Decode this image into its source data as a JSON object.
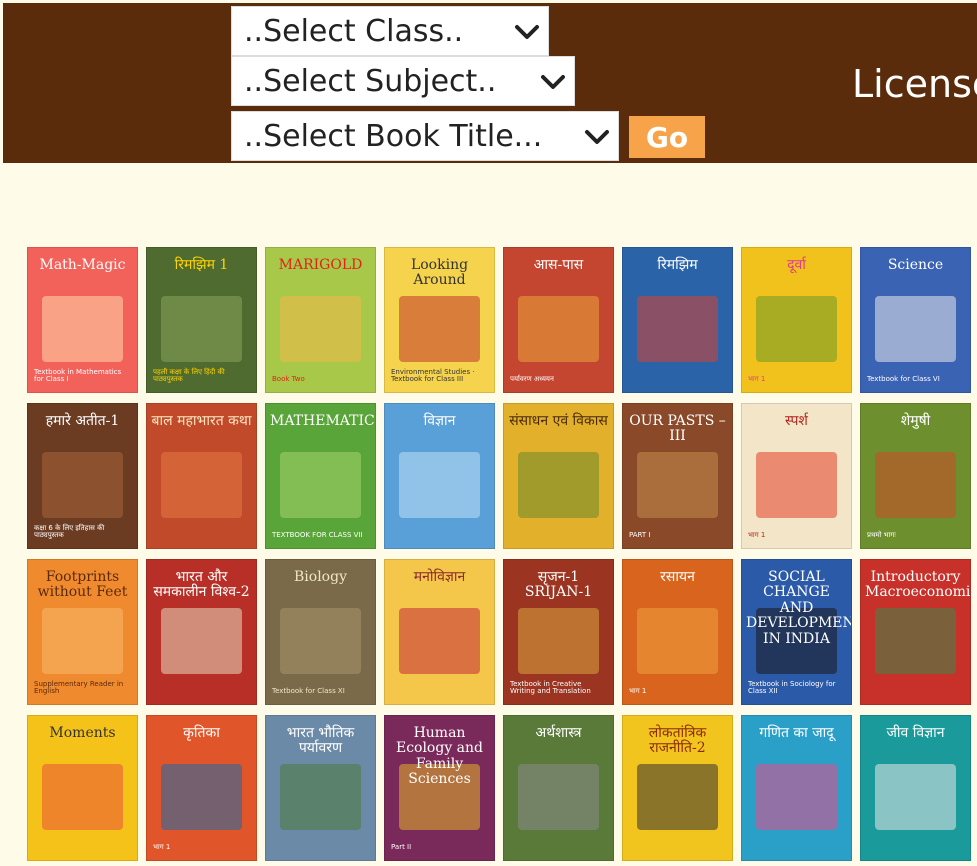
{
  "header": {
    "select_class": "..Select Class..",
    "select_subject": "..Select Subject..",
    "select_book_title": "..Select Book Title...",
    "go_label": "Go",
    "license_text": "License"
  },
  "books": [
    {
      "title": "Math-Magic",
      "sub": "Textbook in Mathematics for Class I",
      "bg": "#f2625b",
      "fg": "#ffffff",
      "art": "#ffd7a8"
    },
    {
      "title": "रिमझिम 1",
      "sub": "पहली कक्षा के लिए हिंदी की पाठ्यपुस्तक",
      "bg": "#4f6b2f",
      "fg": "#ffd400",
      "art": "#8aa45a"
    },
    {
      "title": "MARIGOLD",
      "sub": "Book Two",
      "bg": "#a8c84a",
      "fg": "#e2231a",
      "art": "#f0b94a"
    },
    {
      "title": "Looking Around",
      "sub": "Environmental Studies · Textbook for Class III",
      "bg": "#f6d34c",
      "fg": "#333333",
      "art": "#c0392b"
    },
    {
      "title": "आस-पास",
      "sub": "पर्यावरण अध्ययन",
      "bg": "#c44530",
      "fg": "#ffffff",
      "art": "#e9a43c"
    },
    {
      "title": "रिमझिम",
      "sub": "",
      "bg": "#2a63a8",
      "fg": "#ffffff",
      "art": "#d8412f"
    },
    {
      "title": "दूर्वा",
      "sub": "भाग 1",
      "bg": "#f2c21c",
      "fg": "#e03c8a",
      "art": "#6a9a2a"
    },
    {
      "title": "Science",
      "sub": "Textbook for Class VI",
      "bg": "#3a63b4",
      "fg": "#ffffff",
      "art": "#e9e9e9"
    },
    {
      "title": "हमारे अतीत-1",
      "sub": "कक्षा 6 के लिए इतिहास की पाठ्यपुस्तक",
      "bg": "#6b3b22",
      "fg": "#ffffff",
      "art": "#a8643a"
    },
    {
      "title": "बाल महाभारत कथा",
      "sub": "",
      "bg": "#c14a2a",
      "fg": "#ffe7c2",
      "art": "#e37a42"
    },
    {
      "title": "MATHEMATICS",
      "sub": "TEXTBOOK FOR CLASS VII",
      "bg": "#5aa53a",
      "fg": "#ffffff",
      "art": "#a6d46a"
    },
    {
      "title": "विज्ञान",
      "sub": "",
      "bg": "#5aa0d8",
      "fg": "#ffffff",
      "art": "#bfe0f5"
    },
    {
      "title": "संसाधन एवं विकास",
      "sub": "",
      "bg": "#e2b02a",
      "fg": "#4a2a0a",
      "art": "#6a8a2a"
    },
    {
      "title": "OUR PASTS – III",
      "sub": "PART I",
      "bg": "#8a4a2a",
      "fg": "#ffffff",
      "art": "#c48a4a"
    },
    {
      "title": "स्पर्श",
      "sub": "भाग 1",
      "bg": "#f3e6c8",
      "fg": "#b0261f",
      "art": "#e2402a"
    },
    {
      "title": "शेमुषी",
      "sub": "प्रथमो भागः",
      "bg": "#6e8f2e",
      "fg": "#ffffff",
      "art": "#d04a2a"
    },
    {
      "title": "Footprints without Feet",
      "sub": "Supplementary Reader in English",
      "bg": "#f08a2e",
      "fg": "#5a2a0a",
      "art": "#f7b86a"
    },
    {
      "title": "भारत और समकालीन विश्व-2",
      "sub": "",
      "bg": "#b82f27",
      "fg": "#ffffff",
      "art": "#e8d8c0"
    },
    {
      "title": "Biology",
      "sub": "Textbook for Class XI",
      "bg": "#7a6a4a",
      "fg": "#f0e6c8",
      "art": "#a8946a"
    },
    {
      "title": "मनोविज्ञान",
      "sub": "",
      "bg": "#f4c74a",
      "fg": "#8a2a2a",
      "art": "#c42a3a"
    },
    {
      "title": "सृजन-1 SRIJAN-1",
      "sub": "Textbook in Creative Writing and Translation",
      "bg": "#9b3420",
      "fg": "#ffffff",
      "art": "#d8a640"
    },
    {
      "title": "रसायन",
      "sub": "भाग 1",
      "bg": "#d8641e",
      "fg": "#ffffff",
      "art": "#f0a040"
    },
    {
      "title": "SOCIAL CHANGE AND DEVELOPMENT IN INDIA",
      "sub": "Textbook in Sociology for Class XII",
      "bg": "#2a5aa8",
      "fg": "#ffffff",
      "art": "#1a1a1a"
    },
    {
      "title": "Introductory Macroeconomics",
      "sub": "",
      "bg": "#c8302a",
      "fg": "#ffffff",
      "art": "#3a8a4a"
    },
    {
      "title": "Moments",
      "sub": "",
      "bg": "#f5c21a",
      "fg": "#333333",
      "art": "#e8543a"
    },
    {
      "title": "कृतिका",
      "sub": "भाग 1",
      "bg": "#e0552a",
      "fg": "#ffffff",
      "art": "#1d6aa8"
    },
    {
      "title": "भारत भौतिक पर्यावरण",
      "sub": "",
      "bg": "#6a8aa8",
      "fg": "#ffffff",
      "art": "#4a7a3a"
    },
    {
      "title": "Human Ecology and Family Sciences",
      "sub": "Part II",
      "bg": "#7a2a5a",
      "fg": "#ffffff",
      "art": "#e2b02a"
    },
    {
      "title": "अर्थशास्त्र",
      "sub": "",
      "bg": "#5a7a3a",
      "fg": "#ffffff",
      "art": "#8a8a8a"
    },
    {
      "title": "लोकतांत्रिक राजनीति-2",
      "sub": "",
      "bg": "#f2c41e",
      "fg": "#8a2a0a",
      "art": "#333333"
    },
    {
      "title": "गणित का जादू",
      "sub": "",
      "bg": "#2aa0c8",
      "fg": "#ffffff",
      "art": "#e84a8a"
    },
    {
      "title": "जीव विज्ञान",
      "sub": "",
      "bg": "#1a9a9a",
      "fg": "#ffffff",
      "art": "#e8e8e8"
    }
  ]
}
